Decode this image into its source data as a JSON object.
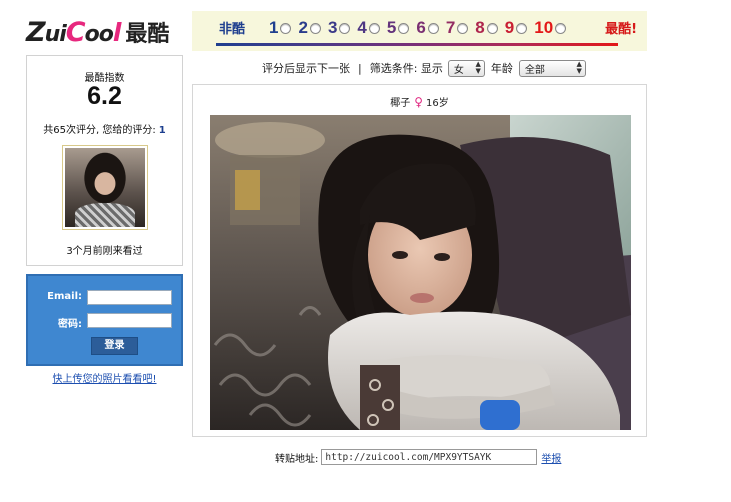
{
  "logo": {
    "word_parts": [
      "Z",
      "ui",
      "C",
      "oo",
      "l"
    ],
    "chinese": "最酷"
  },
  "rating": {
    "left_label": "非酷",
    "right_label": "最酷!",
    "options": [
      {
        "label": "1",
        "color": "#1f3f8f"
      },
      {
        "label": "2",
        "color": "#2a3c8c"
      },
      {
        "label": "3",
        "color": "#3b3a88"
      },
      {
        "label": "4",
        "color": "#4e3783"
      },
      {
        "label": "5",
        "color": "#63337c"
      },
      {
        "label": "6",
        "color": "#7a2f72"
      },
      {
        "label": "7",
        "color": "#932b63"
      },
      {
        "label": "8",
        "color": "#ae254d"
      },
      {
        "label": "9",
        "color": "#c91f33"
      },
      {
        "label": "10",
        "color": "#e31818"
      }
    ]
  },
  "filter": {
    "show_next_text": "评分后显示下一张",
    "separator": "|",
    "filter_text": "筛选条件: 显示",
    "gender_value": "女",
    "age_label": "年龄",
    "age_value": "全部"
  },
  "score": {
    "title": "最酷指数",
    "value": "6.2",
    "info_prefix": "共65次评分, 您给的评分:",
    "my_rating": "1",
    "last_seen": "3个月前刚来看过"
  },
  "login": {
    "email_label": "Email:",
    "password_label": "密码:",
    "email_value": "",
    "password_value": "",
    "submit_label": "登录",
    "upload_link": "快上传您的照片看看吧!"
  },
  "profile": {
    "name": "椰子",
    "gender_icon": "female-icon",
    "age": "16岁"
  },
  "share": {
    "label": "转贴地址:",
    "url": "http://zuicool.com/MPX9YTSAYK",
    "report_label": "举报"
  },
  "colors": {
    "brand_pink": "#e7287e",
    "low_blue": "#1f3f8f",
    "high_red": "#e31818",
    "login_blue": "#3f87d0",
    "link_blue": "#1d4fb0"
  }
}
